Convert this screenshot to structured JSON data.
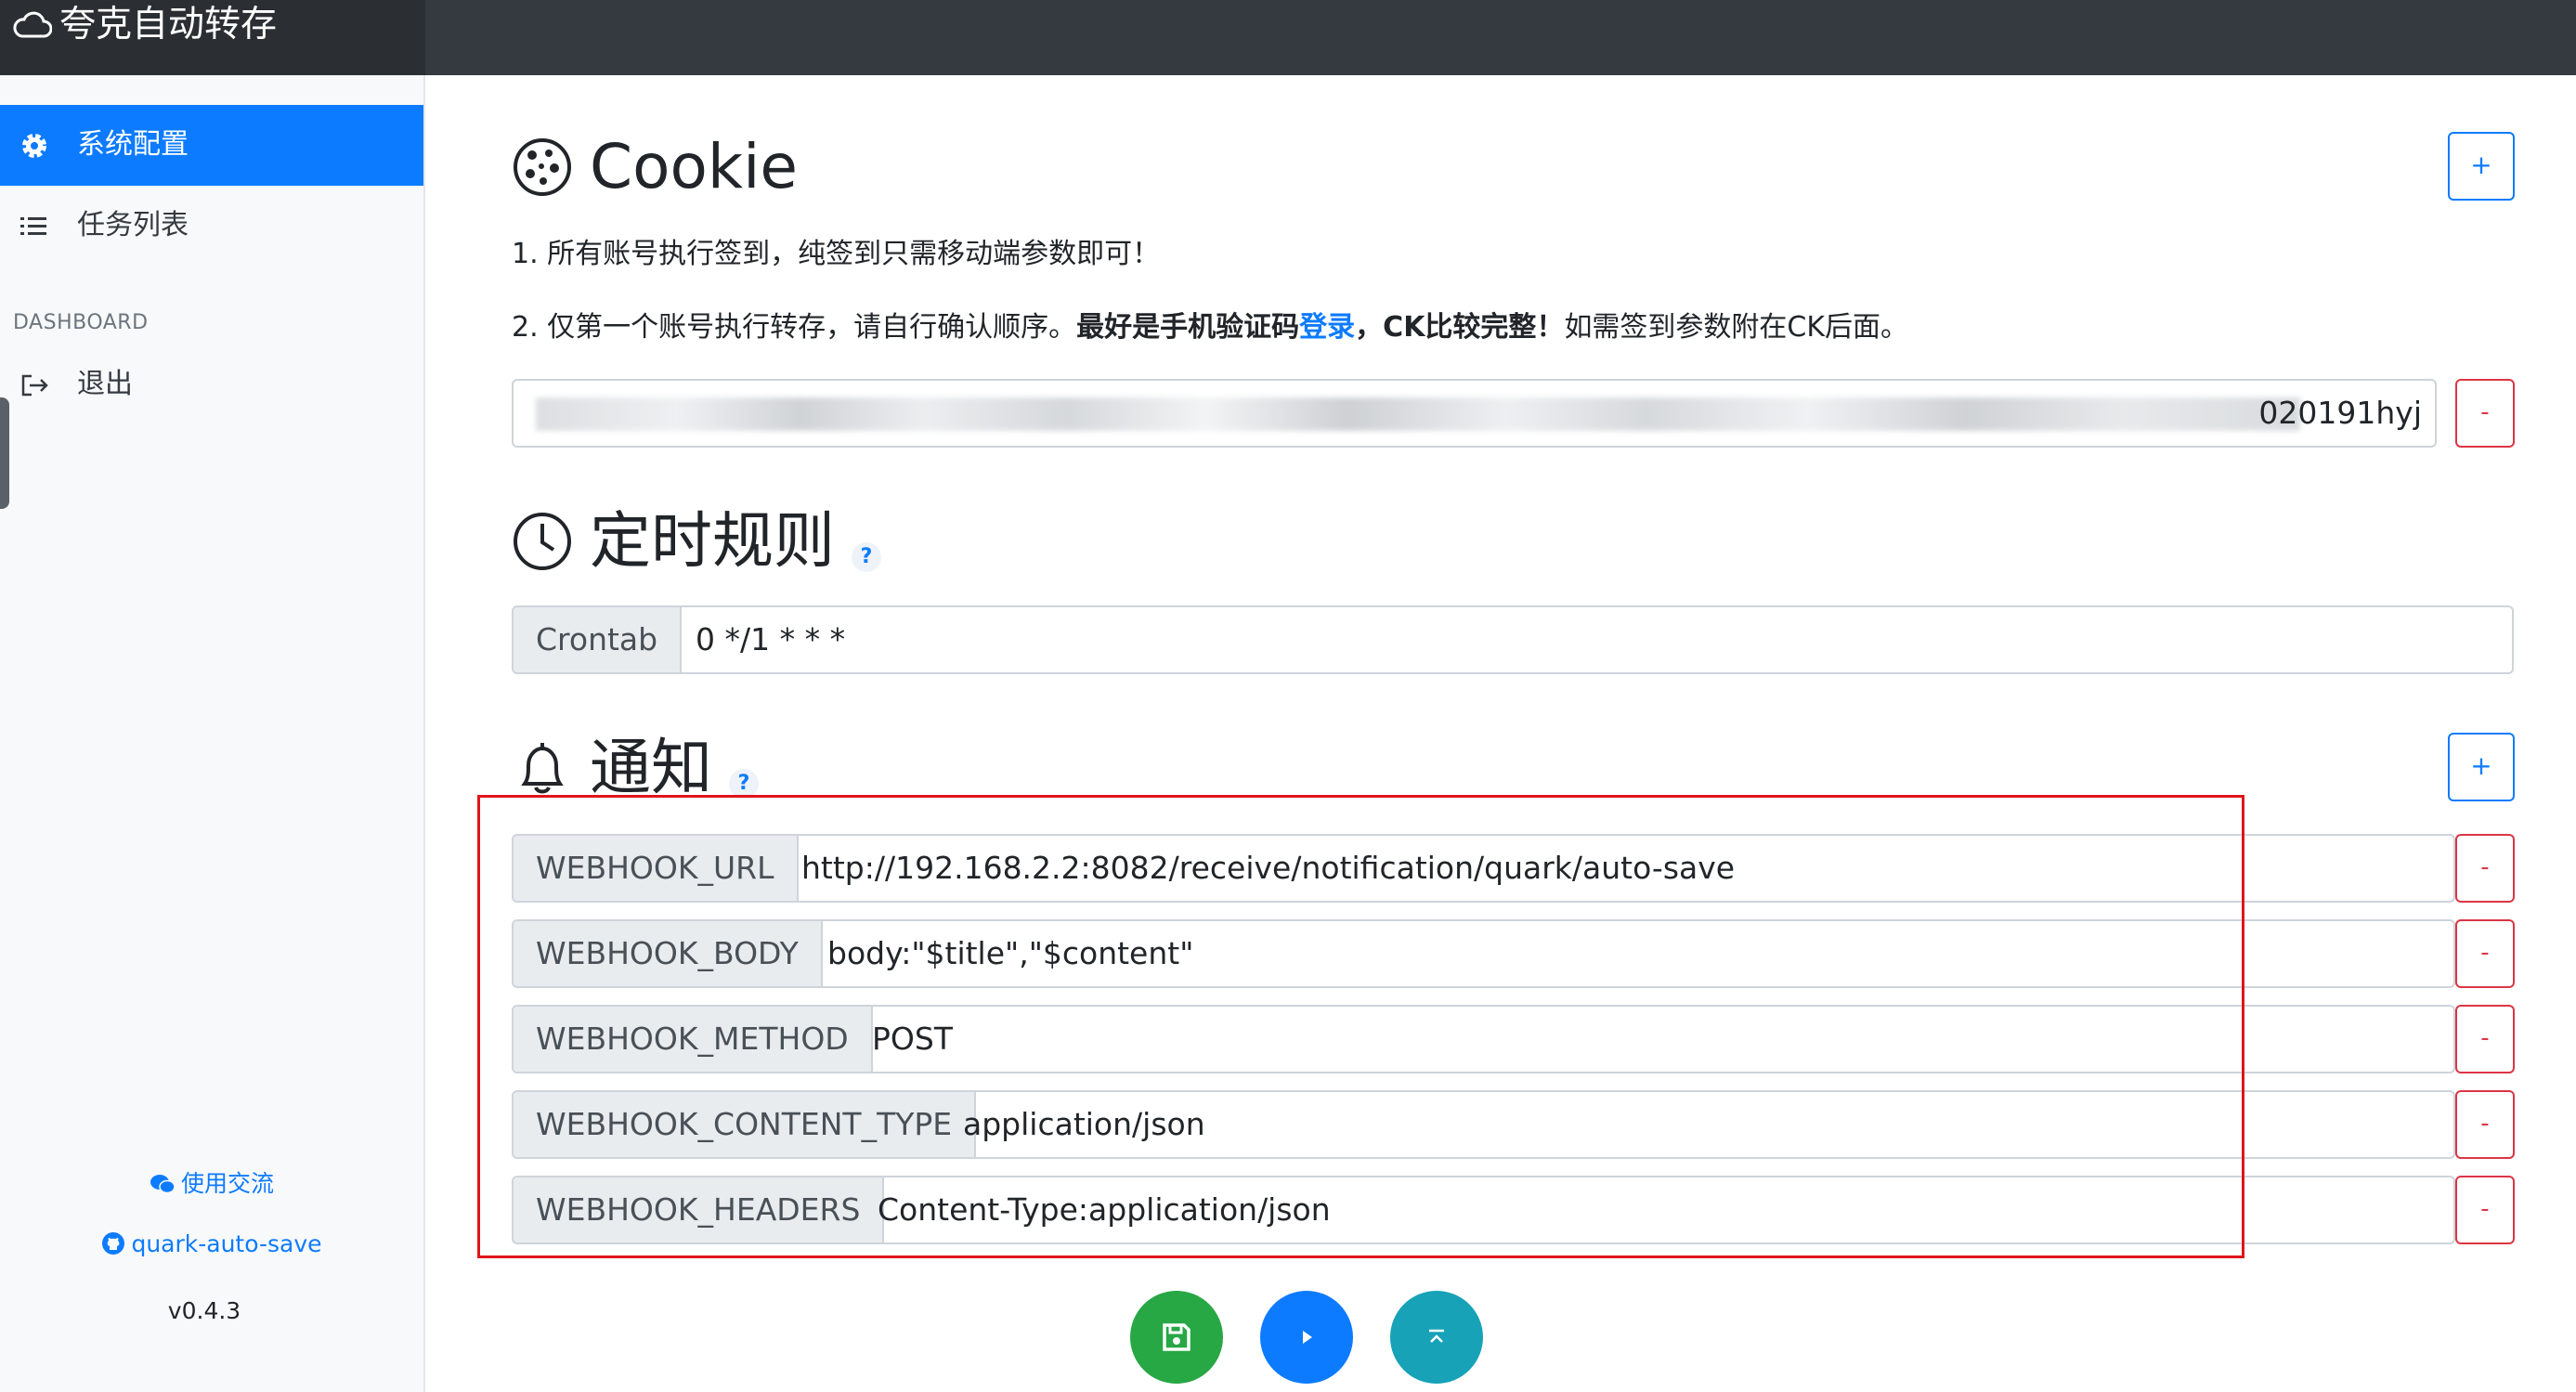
{
  "app": {
    "title": "夸克自动转存"
  },
  "sidebar": {
    "items": [
      {
        "label": "系统配置",
        "icon": "gear-icon",
        "active": true
      },
      {
        "label": "任务列表",
        "icon": "list-icon",
        "active": false
      }
    ],
    "section_label": "DASHBOARD",
    "logout_label": "退出",
    "footer": {
      "chat_link": "使用交流",
      "repo_link": "quark-auto-save",
      "version": "v0.4.3"
    }
  },
  "cookie": {
    "title": "Cookie",
    "note1": "1. 所有账号执行签到，纯签到只需移动端参数即可！",
    "note2_prefix": "2. 仅第一个账号执行转存，请自行确认顺序。",
    "note2_bold": "最好是手机验证码",
    "note2_link": "登录",
    "note2_bold2": "，CK比较完整！",
    "note2_suffix": "如需签到参数附在CK后面。",
    "value_tail": "020191hyj",
    "add_label": "+",
    "remove_label": "-"
  },
  "schedule": {
    "title": "定时规则",
    "help": "?",
    "label": "Crontab",
    "value": "0 */1 * * *"
  },
  "notify": {
    "title": "通知",
    "help": "?",
    "add_label": "+",
    "remove_label": "-",
    "rows": [
      {
        "key": "WEBHOOK_URL",
        "value": "http://192.168.2.2:8082/receive/notification/quark/auto-save"
      },
      {
        "key": "WEBHOOK_BODY",
        "value": "body:\"$title\",\"$content\""
      },
      {
        "key": "WEBHOOK_METHOD",
        "value": "POST"
      },
      {
        "key": "WEBHOOK_CONTENT_TYPE",
        "value": "application/json"
      },
      {
        "key": "WEBHOOK_HEADERS",
        "value": "Content-Type:application/json"
      }
    ]
  },
  "actions": {
    "save_icon": "save-icon",
    "run_icon": "play-icon",
    "top_icon": "scroll-top-icon"
  },
  "colors": {
    "primary": "#0d7bff",
    "danger": "#dc3545",
    "success": "#28a745",
    "info": "#17a2b8",
    "topbar": "#343a40",
    "highlight_box": "#e0151b"
  }
}
